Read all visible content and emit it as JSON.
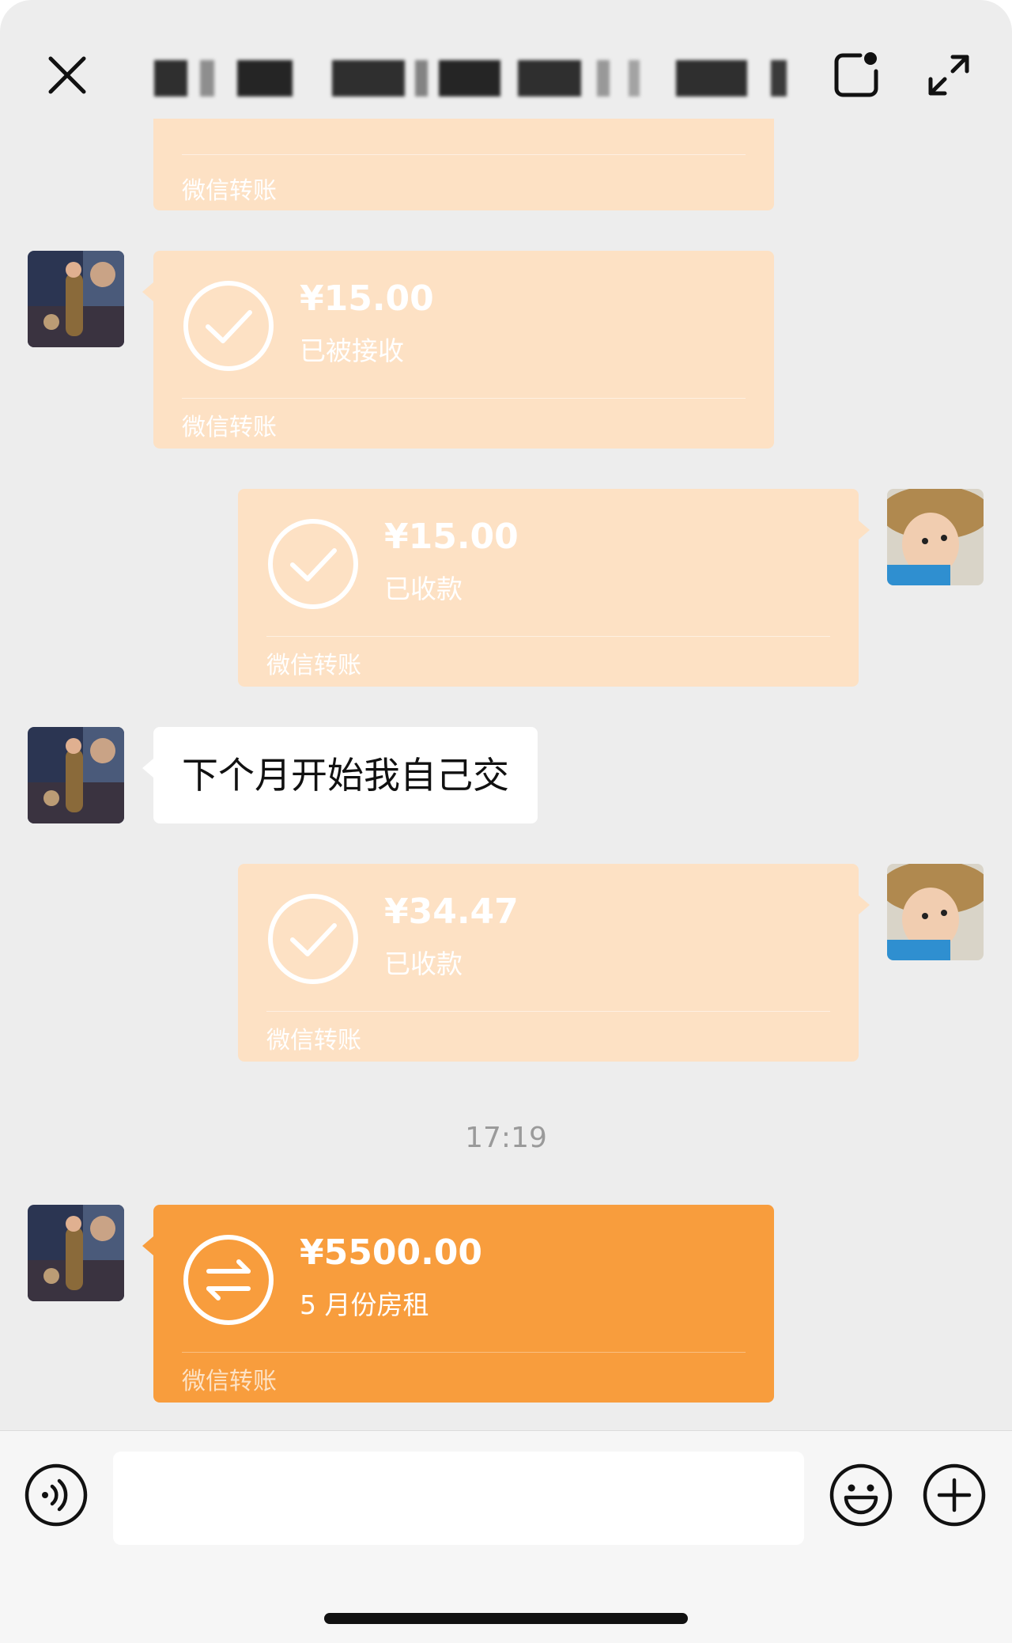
{
  "header": {
    "title": "",
    "close_icon": "close-icon",
    "minimize_icon": "floating-window-icon",
    "expand_icon": "expand-icon"
  },
  "messages": [
    {
      "side": "left",
      "type": "transfer",
      "state": "partial",
      "footer": "微信转账"
    },
    {
      "side": "left",
      "type": "transfer",
      "state": "received",
      "amount": "¥15.00",
      "status": "已被接收",
      "footer": "微信转账"
    },
    {
      "side": "right",
      "type": "transfer",
      "state": "received",
      "amount": "¥15.00",
      "status": "已收款",
      "footer": "微信转账"
    },
    {
      "side": "left",
      "type": "text",
      "text": "下个月开始我自己交"
    },
    {
      "side": "right",
      "type": "transfer",
      "state": "received",
      "amount": "¥34.47",
      "status": "已收款",
      "footer": "微信转账"
    },
    {
      "type": "timestamp",
      "text": "17:19"
    },
    {
      "side": "left",
      "type": "transfer",
      "state": "pending",
      "amount": "¥5500.00",
      "status": "5 月份房租",
      "footer": "微信转账"
    }
  ],
  "input_bar": {
    "voice_icon": "voice-icon",
    "input_value": "",
    "emoji_icon": "emoji-icon",
    "plus_icon": "plus-icon"
  },
  "colors": {
    "background": "#ededed",
    "transfer_done": "#fde1c4",
    "transfer_pending": "#f89d3d",
    "text_bubble": "#ffffff"
  }
}
